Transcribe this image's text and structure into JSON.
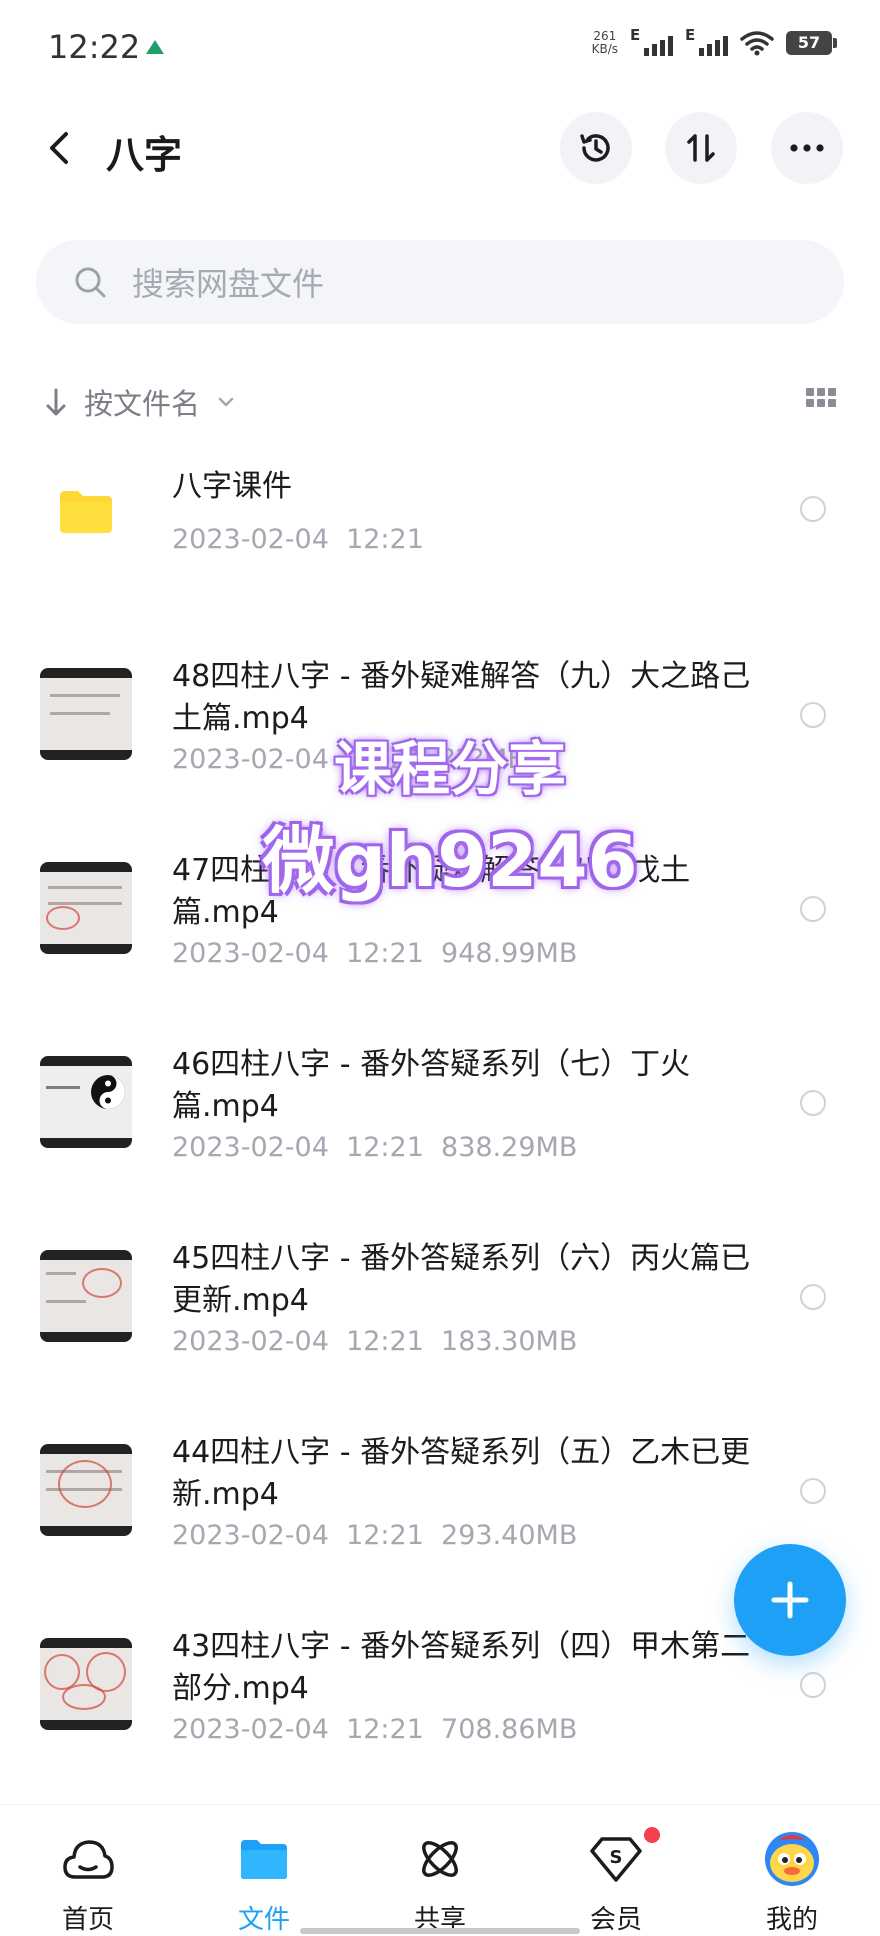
{
  "status_bar": {
    "time": "12:22",
    "net_speed_value": "261",
    "net_speed_unit": "KB/s",
    "signal_1_label": "E",
    "signal_2_label": "E",
    "battery": "57"
  },
  "header": {
    "title": "八字"
  },
  "search": {
    "placeholder": "搜索网盘文件"
  },
  "sort": {
    "label": "按文件名"
  },
  "files": [
    {
      "name": "八字课件",
      "meta": "2023-02-04  12:21",
      "type": "folder"
    },
    {
      "name": "48四柱八字 - 番外疑难解答（九）大之路己土篇.mp4",
      "meta": "2023-02-04  12:21  ???MB",
      "type": "video"
    },
    {
      "name": "47四柱八字 - 番外疑难解答（八）戊土篇.mp4",
      "meta": "2023-02-04  12:21  948.99MB",
      "type": "video"
    },
    {
      "name": "46四柱八字 - 番外答疑系列（七）丁火篇.mp4",
      "meta": "2023-02-04  12:21  838.29MB",
      "type": "video"
    },
    {
      "name": "45四柱八字 - 番外答疑系列（六）丙火篇已更新.mp4",
      "meta": "2023-02-04  12:21  183.30MB",
      "type": "video"
    },
    {
      "name": "44四柱八字 - 番外答疑系列（五）乙木已更新.mp4",
      "meta": "2023-02-04  12:21  293.40MB",
      "type": "video"
    },
    {
      "name": "43四柱八字 - 番外答疑系列（四）甲木第二部分.mp4",
      "meta": "2023-02-04  12:21  708.86MB",
      "type": "video"
    }
  ],
  "watermark": {
    "line1": "课程分享",
    "line2": "微gh9246"
  },
  "bottom_nav": {
    "items": [
      {
        "label": "首页",
        "icon": "cloud-home-icon",
        "active": false
      },
      {
        "label": "文件",
        "icon": "folder-icon",
        "active": true
      },
      {
        "label": "共享",
        "icon": "share-atom-icon",
        "active": false
      },
      {
        "label": "会员",
        "icon": "vip-diamond-icon",
        "active": false
      },
      {
        "label": "我的",
        "icon": "avatar-mascot-icon",
        "active": false
      }
    ]
  },
  "colors": {
    "accent": "#1da1f7",
    "fab": "#1fa0f7",
    "folder": "#fdd835",
    "badge": "#f5414f",
    "watermark_glow": "#a56bf0"
  }
}
